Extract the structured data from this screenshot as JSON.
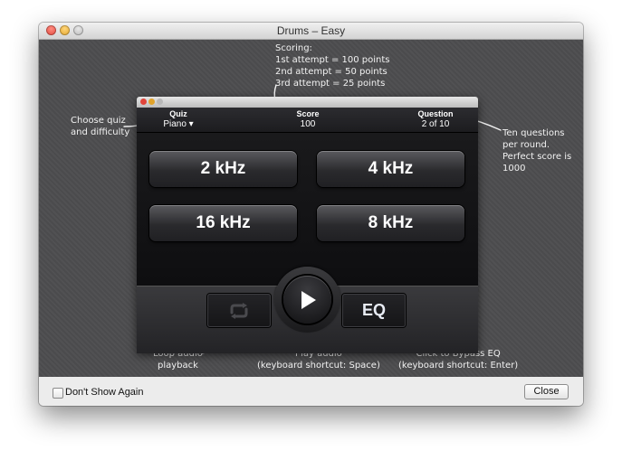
{
  "window": {
    "title": "Drums – Easy"
  },
  "notes": {
    "scoring": [
      "Scoring:",
      "1st attempt = 100 points",
      "2nd attempt = 50 points",
      "3rd attempt = 25 points"
    ],
    "quiz": [
      "Choose quiz",
      "and difficulty"
    ],
    "questions": [
      "Ten questions",
      "per round.",
      "Perfect score is",
      "1000"
    ],
    "loop": [
      "Loop audio",
      "playback"
    ],
    "play": [
      "Play audio",
      "(keyboard shortcut: Space)"
    ],
    "eq": [
      "Click to Bypass EQ",
      "(keyboard shortcut: Enter)"
    ]
  },
  "app": {
    "quiz_label": "Quiz",
    "quiz_value": "Piano ▾",
    "score_label": "Score",
    "score_value": "100",
    "question_label": "Question",
    "question_value": "2 of 10",
    "answers": [
      "2 kHz",
      "4 kHz",
      "16 kHz",
      "8 kHz"
    ],
    "eq_label": "EQ",
    "icons": {
      "loop": "loop-icon",
      "play": "play-icon"
    }
  },
  "footer": {
    "checkbox_label": "Don't Show Again",
    "checkbox_checked": false,
    "close_label": "Close"
  }
}
